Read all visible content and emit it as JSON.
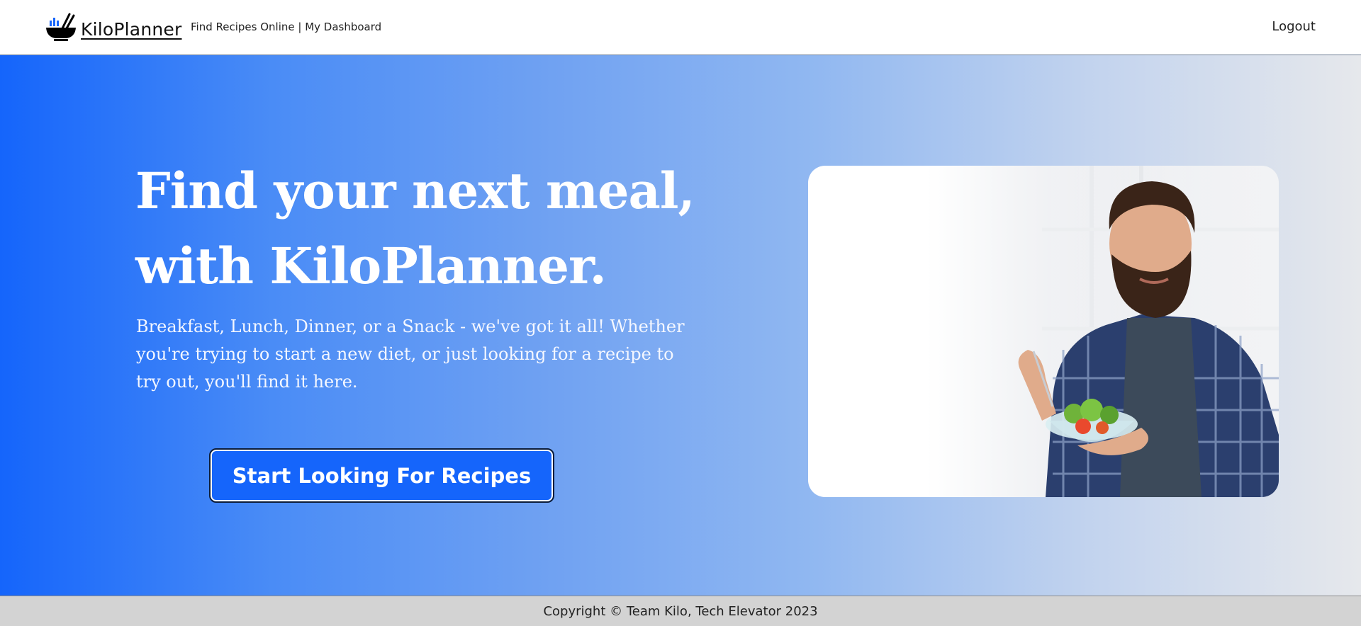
{
  "header": {
    "brand": "KiloPlanner",
    "links": [
      "Find Recipes Online",
      "My Dashboard"
    ],
    "separator": " | ",
    "logout": "Logout"
  },
  "hero": {
    "headline_line1": "Find your next meal,",
    "headline_line2": "with KiloPlanner.",
    "subtext": "Breakfast, Lunch, Dinner, or a Snack - we've got it all! Whether you're trying to start a new diet, or just looking for a recipe to try out, you'll find it here.",
    "cta_label": "Start Looking For Recipes",
    "image_alt": "Man eating a salad"
  },
  "footer": {
    "copyright": "Copyright © Team Kilo, Tech Elevator 2023"
  },
  "colors": {
    "primary": "#1565fb",
    "gradient_end": "#e6e8ec",
    "footer_bg": "#d3d3d3"
  },
  "icons": [
    "bowl-chopsticks-logo-icon"
  ]
}
